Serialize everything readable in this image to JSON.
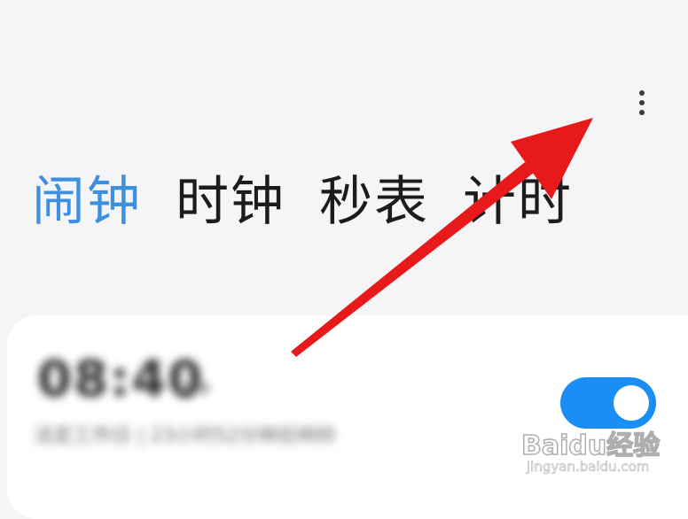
{
  "header": {
    "more_icon": "more-vertical-icon"
  },
  "tabs": [
    {
      "label": "闹钟",
      "active": true
    },
    {
      "label": "时钟",
      "active": false
    },
    {
      "label": "秒表",
      "active": false
    },
    {
      "label": "计时",
      "active": false
    }
  ],
  "alarm": {
    "time": "08:40",
    "ampm": "上午",
    "description": "法定工作日 | 23小时52分钟后响铃",
    "enabled": true
  },
  "colors": {
    "active_tab": "#3d8fe0",
    "toggle_on": "#1a8ef5",
    "arrow": "#e8191b",
    "background": "#f5f5f7"
  },
  "watermark": {
    "logo": "Baidu经验",
    "url": "jingyan.baidu.com"
  }
}
